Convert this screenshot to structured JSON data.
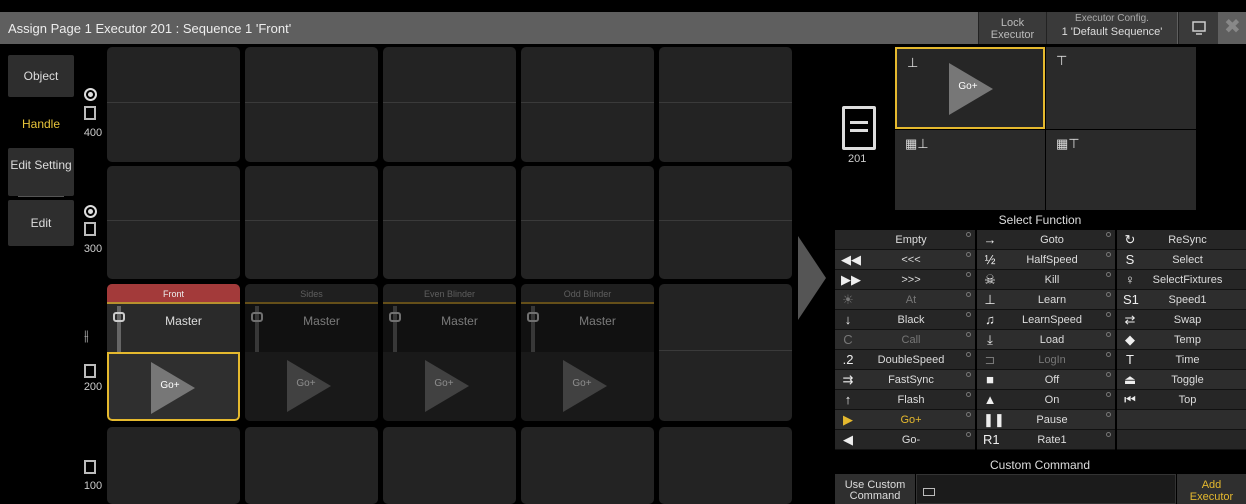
{
  "title": "Assign Page 1 Executor 201 : Sequence 1 'Front'",
  "toolbar": {
    "lock_l1": "Lock",
    "lock_l2": "Executor",
    "cfg_label": "Executor Config.",
    "cfg_value": "1 'Default Sequence'"
  },
  "tabs": {
    "object": "Object",
    "handle": "Handle",
    "edit_setting": "Edit Setting",
    "edit": "Edit"
  },
  "pages": {
    "p400": "400",
    "p300": "300",
    "p200": "200",
    "p100": "100"
  },
  "executors": [
    {
      "name": "Front",
      "master": "Master",
      "go": "Go+"
    },
    {
      "name": "Sides",
      "master": "Master",
      "go": "Go+"
    },
    {
      "name": "Even Blinder",
      "master": "Master",
      "go": "Go+"
    },
    {
      "name": "Odd Blinder",
      "master": "Master",
      "go": "Go+"
    }
  ],
  "preview": {
    "id": "201",
    "go": "Go+"
  },
  "select_function": {
    "title": "Select Function",
    "col1": [
      {
        "i": "",
        "t": "Empty"
      },
      {
        "i": "◀◀",
        "t": "<<<"
      },
      {
        "i": "▶▶",
        "t": ">>>"
      },
      {
        "i": "☀",
        "t": "At"
      },
      {
        "i": "↓",
        "t": "Black"
      },
      {
        "i": "C",
        "t": "Call"
      },
      {
        "i": ".2",
        "t": "DoubleSpeed"
      },
      {
        "i": "⇉",
        "t": "FastSync"
      },
      {
        "i": "↑",
        "t": "Flash"
      },
      {
        "i": "▶",
        "t": "Go+"
      },
      {
        "i": "◀",
        "t": "Go-"
      }
    ],
    "col2": [
      {
        "i": "→",
        "t": "Goto"
      },
      {
        "i": "½",
        "t": "HalfSpeed"
      },
      {
        "i": "☠",
        "t": "Kill"
      },
      {
        "i": "⊥",
        "t": "Learn"
      },
      {
        "i": "♫",
        "t": "LearnSpeed"
      },
      {
        "i": "⤓",
        "t": "Load"
      },
      {
        "i": "⊐",
        "t": "LogIn"
      },
      {
        "i": "■",
        "t": "Off"
      },
      {
        "i": "▲",
        "t": "On"
      },
      {
        "i": "❚❚",
        "t": "Pause"
      },
      {
        "i": "R1",
        "t": "Rate1"
      }
    ],
    "col3": [
      {
        "i": "↻",
        "t": "ReSync"
      },
      {
        "i": "S",
        "t": "Select"
      },
      {
        "i": "♀",
        "t": "SelectFixtures"
      },
      {
        "i": "S1",
        "t": "Speed1"
      },
      {
        "i": "⇄",
        "t": "Swap"
      },
      {
        "i": "◆",
        "t": "Temp"
      },
      {
        "i": "T",
        "t": "Time"
      },
      {
        "i": "⏏",
        "t": "Toggle"
      },
      {
        "i": "⏮",
        "t": "Top"
      }
    ]
  },
  "custom": {
    "title": "Custom Command",
    "use_l1": "Use Custom",
    "use_l2": "Command",
    "add_l1": "Add",
    "add_l2": "Executor"
  }
}
